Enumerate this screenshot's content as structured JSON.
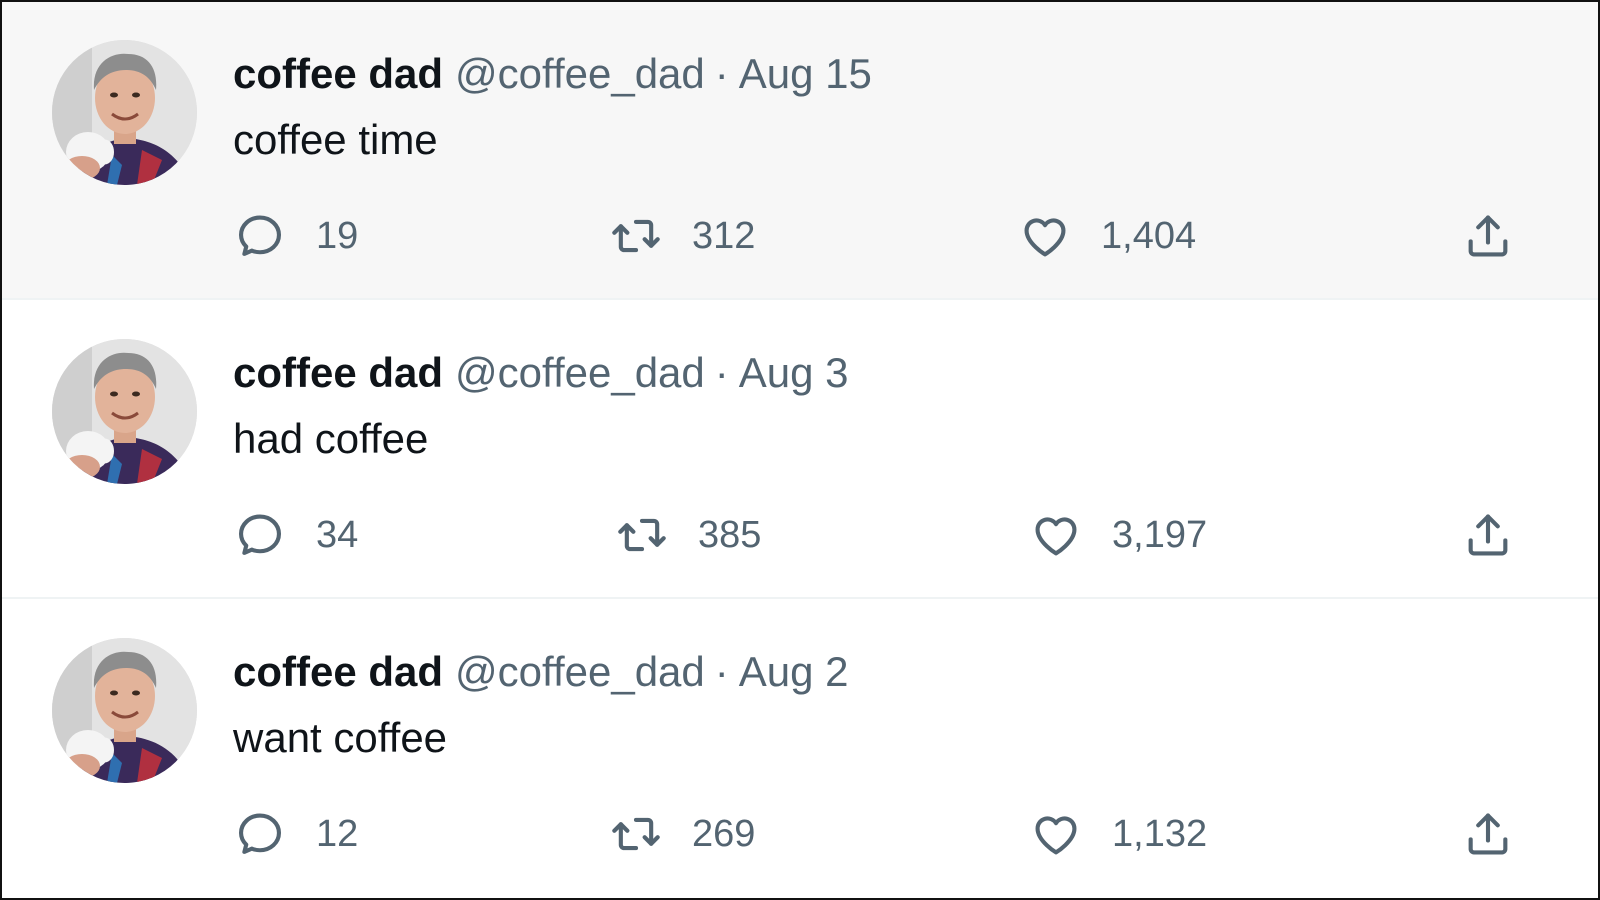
{
  "tweets": [
    {
      "author_name": "coffee dad",
      "handle": "@coffee_dad",
      "separator": "·",
      "date": "Aug 15",
      "text": "coffee time",
      "replies": "19",
      "retweets": "312",
      "likes": "1,404",
      "hovered": true
    },
    {
      "author_name": "coffee dad",
      "handle": "@coffee_dad",
      "separator": "·",
      "date": "Aug 3",
      "text": "had coffee",
      "replies": "34",
      "retweets": "385",
      "likes": "3,197",
      "hovered": false
    },
    {
      "author_name": "coffee dad",
      "handle": "@coffee_dad",
      "separator": "·",
      "date": "Aug 2",
      "text": "want coffee",
      "replies": "12",
      "retweets": "269",
      "likes": "1,132",
      "hovered": false
    }
  ],
  "icons": {
    "reply": "reply-icon",
    "retweet": "retweet-icon",
    "like": "heart-icon",
    "share": "share-icon"
  },
  "colors": {
    "text_primary": "#0f1419",
    "text_secondary": "#536471",
    "hover_background": "#f7f7f7",
    "divider": "#eff3f4"
  }
}
